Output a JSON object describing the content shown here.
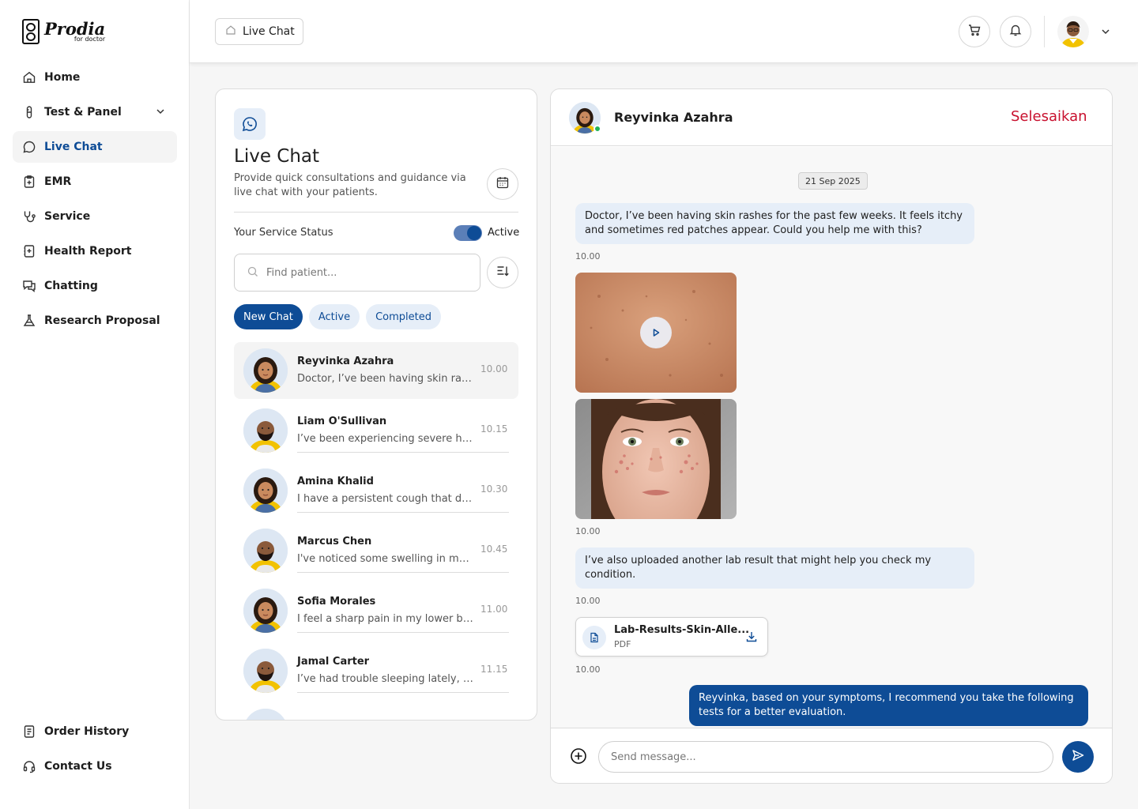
{
  "brand": {
    "name": "Prodia",
    "tagline": "for doctor"
  },
  "sidebar": {
    "items": [
      {
        "label": "Home",
        "icon": "home-icon"
      },
      {
        "label": "Test & Panel",
        "icon": "test-tube-icon"
      },
      {
        "label": "Live Chat",
        "icon": "chat-icon"
      },
      {
        "label": "EMR",
        "icon": "clipboard-icon"
      },
      {
        "label": "Service",
        "icon": "stethoscope-icon"
      },
      {
        "label": "Health Report",
        "icon": "report-icon"
      },
      {
        "label": "Chatting",
        "icon": "messages-icon"
      },
      {
        "label": "Research Proposal",
        "icon": "research-icon"
      }
    ],
    "bottom": [
      {
        "label": "Order History",
        "icon": "receipt-icon"
      },
      {
        "label": "Contact Us",
        "icon": "headset-icon"
      }
    ]
  },
  "header": {
    "breadcrumb": "Live Chat"
  },
  "panel": {
    "title": "Live Chat",
    "description": "Provide quick consultations and guidance via live chat with your patients.",
    "status_label": "Your Service Status",
    "status_value": "Active",
    "search_placeholder": "Find patient...",
    "tabs": [
      "New Chat",
      "Active",
      "Completed"
    ],
    "chats": [
      {
        "name": "Reyvinka Azahra",
        "preview": "Doctor, I’ve been having skin rashes for the past few weeks.",
        "time": "10.00"
      },
      {
        "name": "Liam O'Sullivan",
        "preview": "I’ve been experiencing severe headaches lately.",
        "time": "10.15"
      },
      {
        "name": "Amina Khalid",
        "preview": "I have a persistent cough that doesn't go away.",
        "time": "10.30"
      },
      {
        "name": "Marcus Chen",
        "preview": "I've noticed some swelling in my ankles.",
        "time": "10.45"
      },
      {
        "name": "Sofia Morales",
        "preview": "I feel a sharp pain in my lower back.",
        "time": "11.00"
      },
      {
        "name": "Jamal Carter",
        "preview": "I’ve had trouble sleeping lately, doctor.",
        "time": "11.15"
      }
    ]
  },
  "conversation": {
    "patient": "Reyvinka Azahra",
    "finish_label": "Selesaikan",
    "date": "21 Sep 2025",
    "msg1": "Doctor, I’ve been having skin rashes for the past few weeks. It feels itchy and sometimes red patches appear. Could you help me with this?",
    "msg2": "I’ve also uploaded another lab result that might help you check my condition.",
    "msg3": "Reyvinka, based on your symptoms, I recommend you take the following tests for a better evaluation.",
    "time": "10.00",
    "file_name": "Lab-Results-Skin-Alle...",
    "file_type": "PDF",
    "input_placeholder": "Send message..."
  },
  "colors": {
    "primary": "#0e4c96",
    "danger": "#c8102e",
    "bubble_in": "#e6eef8",
    "online": "#22b35a"
  }
}
